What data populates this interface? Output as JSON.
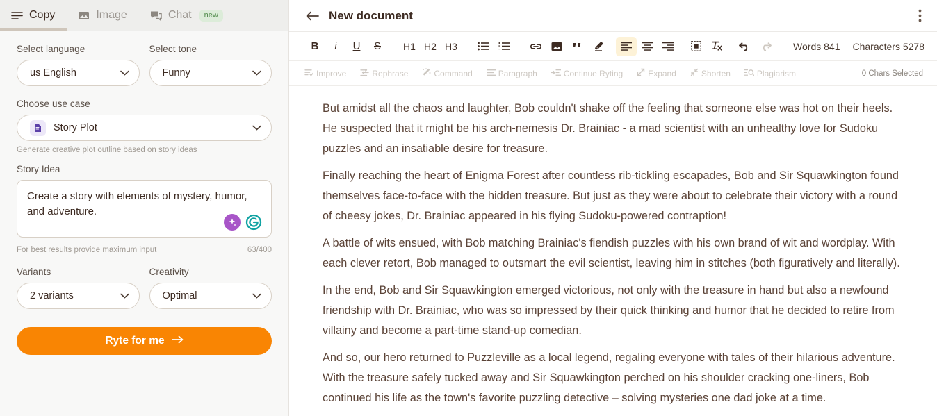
{
  "tabs": [
    {
      "label": "Copy",
      "icon": "lines-icon",
      "active": true,
      "badge": ""
    },
    {
      "label": "Image",
      "icon": "image-icon",
      "active": false,
      "badge": ""
    },
    {
      "label": "Chat",
      "icon": "chat-icon",
      "active": false,
      "badge": "new"
    }
  ],
  "sidebar": {
    "language": {
      "label": "Select language",
      "value": "us English"
    },
    "tone": {
      "label": "Select tone",
      "value": "Funny"
    },
    "use_case": {
      "label": "Choose use case",
      "value": "Story Plot",
      "icon": "story-plot-icon",
      "helper": "Generate creative plot outline based on story ideas"
    },
    "story_idea": {
      "label": "Story Idea",
      "value": "Create a story with elements of mystery, humor, and adventure.",
      "placeholder": "Create a story with elements of mystery, humor, and adventure.",
      "helper": "For best results provide maximum input",
      "counter": "63/400"
    },
    "variants": {
      "label": "Variants",
      "value": "2 variants"
    },
    "creativity": {
      "label": "Creativity",
      "value": "Optimal"
    },
    "submit": {
      "label": "Ryte for me"
    }
  },
  "document": {
    "title": "New document",
    "words_label": "Words 841",
    "characters_label": "Characters 5278",
    "chars_selected": "0 Chars Selected",
    "paragraphs": [
      "But amidst all the chaos and laughter, Bob couldn't shake off the feeling that someone else was hot on their heels. He suspected that it might be his arch-nemesis Dr. Brainiac - a mad scientist with an unhealthy love for Sudoku puzzles and an insatiable desire for treasure.",
      "Finally reaching the heart of Enigma Forest after countless rib-tickling escapades, Bob and Sir Squawkington found themselves face-to-face with the hidden treasure. But just as they were about to celebrate their victory with a round of cheesy jokes, Dr. Brainiac appeared in his flying Sudoku-powered contraption!",
      "A battle of wits ensued, with Bob matching Brainiac's fiendish puzzles with his own brand of wit and wordplay. With each clever retort, Bob managed to outsmart the evil scientist, leaving him in stitches (both figuratively and literally).",
      "In the end, Bob and Sir Squawkington emerged victorious, not only with the treasure in hand but also a newfound friendship with Dr. Brainiac, who was so impressed by their quick thinking and humor that he decided to retire from villainy and become a part-time stand-up comedian.",
      "And so, our hero returned to Puzzleville as a local legend, regaling everyone with tales of their hilarious adventure. With the treasure safely tucked away and Sir Squawkington perched on his shoulder cracking one-liners, Bob continued his life as the town's favorite puzzling detective – solving mysteries one dad joke at a time."
    ]
  },
  "toolbar": {
    "items": [
      {
        "name": "bold",
        "label": "B"
      },
      {
        "name": "italic",
        "label": "i"
      },
      {
        "name": "underline",
        "label": "U"
      },
      {
        "name": "strikethrough",
        "label": "S"
      },
      {
        "name": "heading-1",
        "label": "H1"
      },
      {
        "name": "heading-2",
        "label": "H2"
      },
      {
        "name": "heading-3",
        "label": "H3"
      }
    ]
  },
  "ai_actions": [
    {
      "label": "Improve",
      "icon": "improve-icon"
    },
    {
      "label": "Rephrase",
      "icon": "rephrase-icon"
    },
    {
      "label": "Command",
      "icon": "magic-wand-icon"
    },
    {
      "label": "Paragraph",
      "icon": "paragraph-icon"
    },
    {
      "label": "Continue Ryting",
      "icon": "continue-icon"
    },
    {
      "label": "Expand",
      "icon": "expand-icon"
    },
    {
      "label": "Shorten",
      "icon": "shorten-icon"
    },
    {
      "label": "Plagiarism",
      "icon": "plagiarism-icon"
    }
  ],
  "colors": {
    "accent_orange": "#f98503",
    "active_tab_underline": "#cfc6bb",
    "badge_green_bg": "#dcecd9",
    "badge_green_text": "#4f8a4a",
    "text_brown": "#3d2b22",
    "body_text": "#5b4337",
    "highlight_yellow": "#fdf2d7",
    "sparkle_purple": "#a855c8",
    "grammarly_teal": "#11a3a3"
  }
}
